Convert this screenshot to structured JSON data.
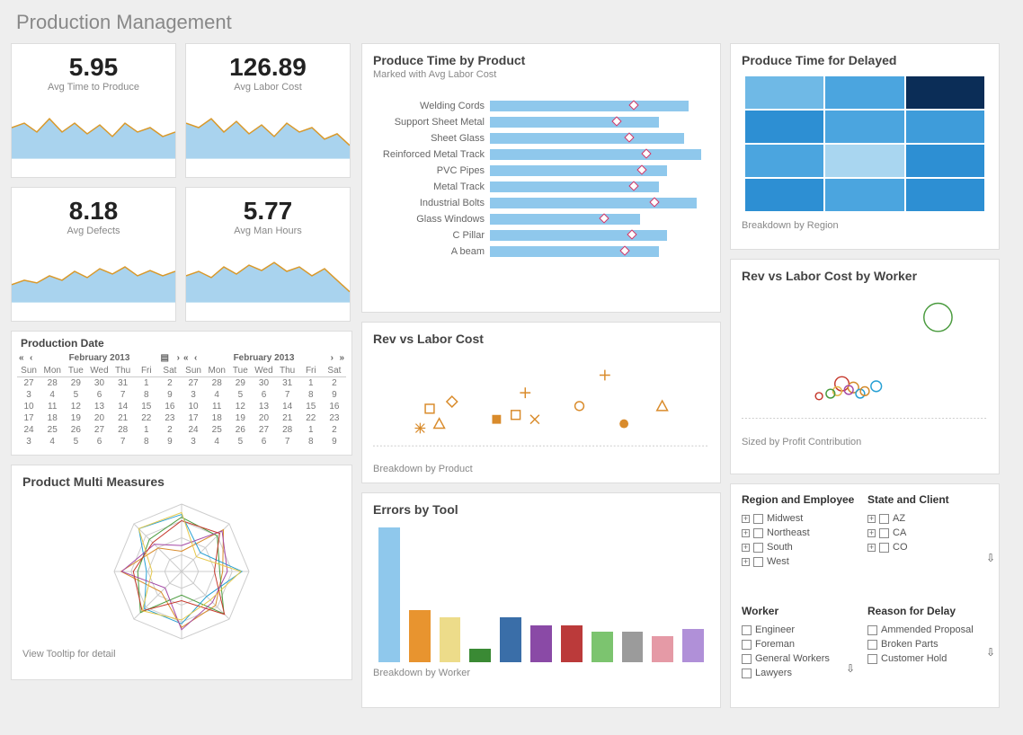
{
  "page": {
    "title": "Production Management"
  },
  "kpi": [
    {
      "value": "5.95",
      "label": "Avg Time to Produce",
      "series": [
        35,
        40,
        30,
        45,
        30,
        40,
        28,
        38,
        25,
        40,
        30,
        35,
        25,
        30
      ]
    },
    {
      "value": "126.89",
      "label": "Avg Labor Cost",
      "series": [
        40,
        35,
        45,
        30,
        42,
        28,
        38,
        25,
        40,
        30,
        35,
        22,
        28,
        15
      ]
    },
    {
      "value": "8.18",
      "label": "Avg Defects",
      "series": [
        20,
        25,
        22,
        30,
        25,
        35,
        28,
        38,
        32,
        40,
        30,
        36,
        30,
        35
      ]
    },
    {
      "value": "5.77",
      "label": "Avg Man Hours",
      "series": [
        30,
        35,
        28,
        40,
        32,
        42,
        36,
        45,
        35,
        40,
        30,
        38,
        25,
        12
      ]
    }
  ],
  "calendar": {
    "title": "Production Date",
    "month": "February 2013",
    "dow": [
      "Sun",
      "Mon",
      "Tue",
      "Wed",
      "Thu",
      "Fri",
      "Sat"
    ],
    "rows": [
      [
        "27",
        "28",
        "29",
        "30",
        "31",
        "1",
        "2"
      ],
      [
        "3",
        "4",
        "5",
        "6",
        "7",
        "8",
        "9"
      ],
      [
        "10",
        "11",
        "12",
        "13",
        "14",
        "15",
        "16"
      ],
      [
        "17",
        "18",
        "19",
        "20",
        "21",
        "22",
        "23"
      ],
      [
        "24",
        "25",
        "26",
        "27",
        "28",
        "1",
        "2"
      ],
      [
        "3",
        "4",
        "5",
        "6",
        "7",
        "8",
        "9"
      ]
    ]
  },
  "chart_data": [
    {
      "id": "produce_time_by_product",
      "type": "bar",
      "title": "Produce Time by Product",
      "subtitle": "Marked with Avg Labor Cost",
      "orientation": "horizontal",
      "xlim": [
        0,
        260
      ],
      "categories": [
        "Welding Cords",
        "Support Sheet Metal",
        "Sheet Glass",
        "Reinforced Metal Track",
        "PVC Pipes",
        "Metal Track",
        "Industrial Bolts",
        "Glass Windows",
        "C Pillar",
        "A beam"
      ],
      "values": [
        235,
        200,
        230,
        250,
        210,
        200,
        245,
        178,
        210,
        200
      ],
      "marker_x": [
        170,
        150,
        165,
        185,
        180,
        170,
        195,
        135,
        168,
        160
      ]
    },
    {
      "id": "rev_vs_labor_cost",
      "type": "scatter",
      "title": "Rev vs Labor Cost",
      "footer": "Breakdown by Product",
      "xlim": [
        0,
        100
      ],
      "ylim": [
        0,
        100
      ],
      "points": [
        {
          "x": 15,
          "y": 42,
          "shape": "square-open"
        },
        {
          "x": 12,
          "y": 20,
          "shape": "asterisk"
        },
        {
          "x": 18,
          "y": 25,
          "shape": "triangle-open"
        },
        {
          "x": 22,
          "y": 50,
          "shape": "diamond-open"
        },
        {
          "x": 36,
          "y": 30,
          "shape": "square"
        },
        {
          "x": 42,
          "y": 35,
          "shape": "square-open"
        },
        {
          "x": 45,
          "y": 60,
          "shape": "plus"
        },
        {
          "x": 48,
          "y": 30,
          "shape": "cross"
        },
        {
          "x": 62,
          "y": 45,
          "shape": "circle-open"
        },
        {
          "x": 70,
          "y": 80,
          "shape": "plus"
        },
        {
          "x": 76,
          "y": 25,
          "shape": "circle"
        },
        {
          "x": 88,
          "y": 45,
          "shape": "triangle-open"
        }
      ]
    },
    {
      "id": "produce_time_for_delayed",
      "type": "heatmap",
      "title": "Produce Time for Delayed",
      "footer": "Breakdown by Region",
      "rows": 4,
      "cols": 3,
      "colors": [
        "#6fb9e6",
        "#4ba5df",
        "#0b2d57",
        "#2d8fd3",
        "#4ba5df",
        "#3e9cda",
        "#4ba5df",
        "#a9d6f0",
        "#2d8fd3",
        "#2d8fd3",
        "#4ba5df",
        "#2d8fd3"
      ]
    },
    {
      "id": "rev_vs_labor_by_worker",
      "type": "scatter",
      "title": "Rev vs Labor Cost by Worker",
      "footer": "Sized by Profit Contribution",
      "xlim": [
        0,
        100
      ],
      "ylim": [
        0,
        100
      ],
      "points": [
        {
          "x": 82,
          "y": 82,
          "r": 16,
          "color": "#4a9b3e"
        },
        {
          "x": 40,
          "y": 28,
          "r": 8,
          "color": "#c6392d"
        },
        {
          "x": 45,
          "y": 25,
          "r": 6,
          "color": "#d38a2a"
        },
        {
          "x": 48,
          "y": 20,
          "r": 5,
          "color": "#27a0d4"
        },
        {
          "x": 38,
          "y": 22,
          "r": 5,
          "color": "#e6b84a"
        },
        {
          "x": 35,
          "y": 20,
          "r": 5,
          "color": "#4a9b3e"
        },
        {
          "x": 43,
          "y": 23,
          "r": 5,
          "color": "#a54aa6"
        },
        {
          "x": 55,
          "y": 26,
          "r": 6,
          "color": "#27a0d4"
        },
        {
          "x": 50,
          "y": 22,
          "r": 5,
          "color": "#d38a2a"
        },
        {
          "x": 30,
          "y": 18,
          "r": 4,
          "color": "#c6392d"
        }
      ]
    },
    {
      "id": "product_multi_measures",
      "type": "radar",
      "title": "Product Multi Measures",
      "footer": "View Tooltip for detail",
      "axes": 8,
      "series_count": 6
    },
    {
      "id": "errors_by_tool",
      "type": "bar",
      "title": "Errors by Tool",
      "footer": "Breakdown by Worker",
      "ylim": [
        0,
        160
      ],
      "categories": [
        "",
        "",
        "",
        "",
        "",
        "",
        "",
        "",
        "",
        "",
        ""
      ],
      "values": [
        155,
        60,
        52,
        15,
        52,
        42,
        42,
        35,
        35,
        30,
        38
      ],
      "colors": [
        "#8fc8ec",
        "#e8942f",
        "#eddc8a",
        "#3a8a34",
        "#3a6ea8",
        "#8a4aa6",
        "#bb3a3a",
        "#7cc46f",
        "#9b9b9b",
        "#e59aa6",
        "#b090d8"
      ]
    }
  ],
  "filters": {
    "region_employee": {
      "title": "Region and Employee",
      "items": [
        "Midwest",
        "Northeast",
        "South",
        "West"
      ]
    },
    "state_client": {
      "title": "State and Client",
      "items": [
        "AZ",
        "CA",
        "CO"
      ]
    },
    "worker": {
      "title": "Worker",
      "items": [
        "Engineer",
        "Foreman",
        "General Workers",
        "Lawyers"
      ]
    },
    "reason_delay": {
      "title": "Reason for Delay",
      "items": [
        "Ammended Proposal",
        "Broken Parts",
        "Customer Hold"
      ]
    }
  }
}
